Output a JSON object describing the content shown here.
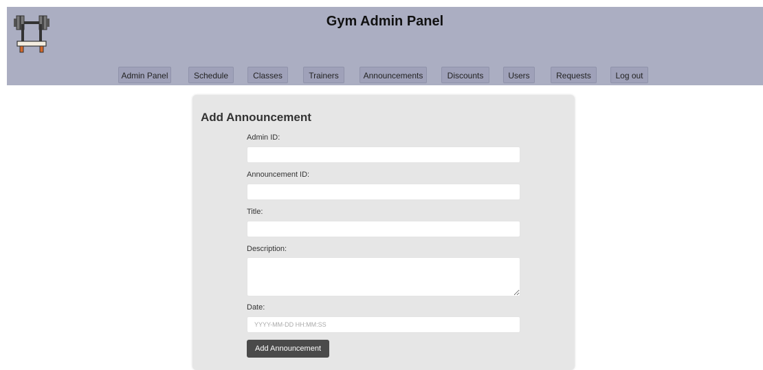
{
  "header": {
    "title": "Gym Admin Panel",
    "logo_icon": "barbell-bench-icon"
  },
  "nav": {
    "items": [
      {
        "label": "Admin Panel"
      },
      {
        "label": "Schedule"
      },
      {
        "label": "Classes"
      },
      {
        "label": "Trainers"
      },
      {
        "label": "Announcements"
      },
      {
        "label": "Discounts"
      },
      {
        "label": "Users"
      },
      {
        "label": "Requests"
      },
      {
        "label": "Log out"
      }
    ]
  },
  "form": {
    "title": "Add Announcement",
    "admin_id_label": "Admin ID:",
    "admin_id_value": "",
    "announcement_id_label": "Announcement ID:",
    "announcement_id_value": "",
    "title_label": "Title:",
    "title_value": "",
    "description_label": "Description:",
    "description_value": "",
    "date_label": "Date:",
    "date_placeholder": "YYYY-MM-DD HH:MM:SS",
    "submit_label": "Add Announcement"
  },
  "colors": {
    "header_bg": "#abaec2",
    "nav_button_bg": "#9fa1b9",
    "card_bg": "#e6e6e6",
    "submit_bg": "#4a4a4a"
  }
}
